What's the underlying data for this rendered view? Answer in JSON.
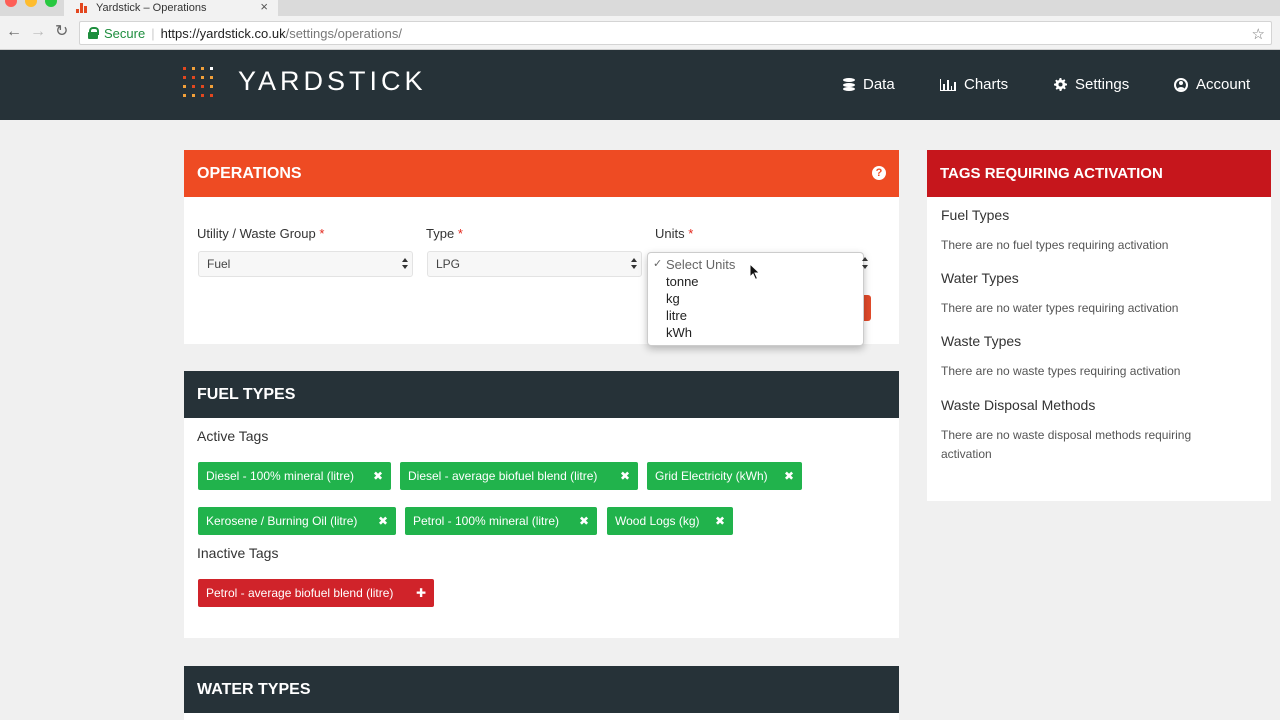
{
  "browser": {
    "tab_title": "Yardstick – Operations",
    "tab_close": "×",
    "secure_label": "Secure",
    "url_host": "https://yardstick.co.uk",
    "url_path": "/settings/operations/",
    "back_icon": "←",
    "forward_icon": "→",
    "reload_icon": "↻",
    "bookmark_icon": "☆"
  },
  "header": {
    "brand": "YARDSTICK",
    "logo_colors": [
      "#e3471f",
      "#f2a13a",
      "#ffffff"
    ],
    "nav": [
      {
        "label": "Data",
        "icon": "database-icon"
      },
      {
        "label": "Charts",
        "icon": "bar-chart-icon"
      },
      {
        "label": "Settings",
        "icon": "gear-icon"
      },
      {
        "label": "Account",
        "icon": "user-icon"
      }
    ]
  },
  "operations": {
    "title": "OPERATIONS",
    "help": "?",
    "fields": {
      "group_label": "Utility / Waste Group",
      "group_value": "Fuel",
      "type_label": "Type",
      "type_value": "LPG",
      "units_label": "Units",
      "required_mark": "*"
    },
    "units_dropdown": {
      "check": "✓",
      "options": [
        "Select Units",
        "tonne",
        "kg",
        "litre",
        "kWh"
      ],
      "selected": "Select Units"
    }
  },
  "fuel_types": {
    "title": "FUEL TYPES",
    "active_label": "Active Tags",
    "inactive_label": "Inactive Tags",
    "remove_icon": "✖",
    "add_icon": "✚",
    "active_tags": [
      "Diesel - 100% mineral (litre)",
      "Diesel - average biofuel blend (litre)",
      "Grid Electricity (kWh)",
      "Kerosene / Burning Oil (litre)",
      "Petrol - 100% mineral (litre)",
      "Wood Logs (kg)"
    ],
    "inactive_tags": [
      "Petrol - average biofuel blend (litre)"
    ]
  },
  "water_types": {
    "title": "WATER TYPES"
  },
  "activation": {
    "title": "TAGS REQUIRING ACTIVATION",
    "sections": [
      {
        "title": "Fuel Types",
        "text": "There are no fuel types requiring activation"
      },
      {
        "title": "Water Types",
        "text": "There are no water types requiring activation"
      },
      {
        "title": "Waste Types",
        "text": "There are no waste types requiring activation"
      },
      {
        "title": "Waste Disposal Methods",
        "text": "There are no waste disposal methods requiring activation"
      }
    ]
  },
  "colors": {
    "ops_header": "#ee4b23",
    "dark_header": "#263238",
    "activation_header": "#c6161c",
    "active_tag": "#21b34c",
    "inactive_tag": "#d0232a"
  }
}
